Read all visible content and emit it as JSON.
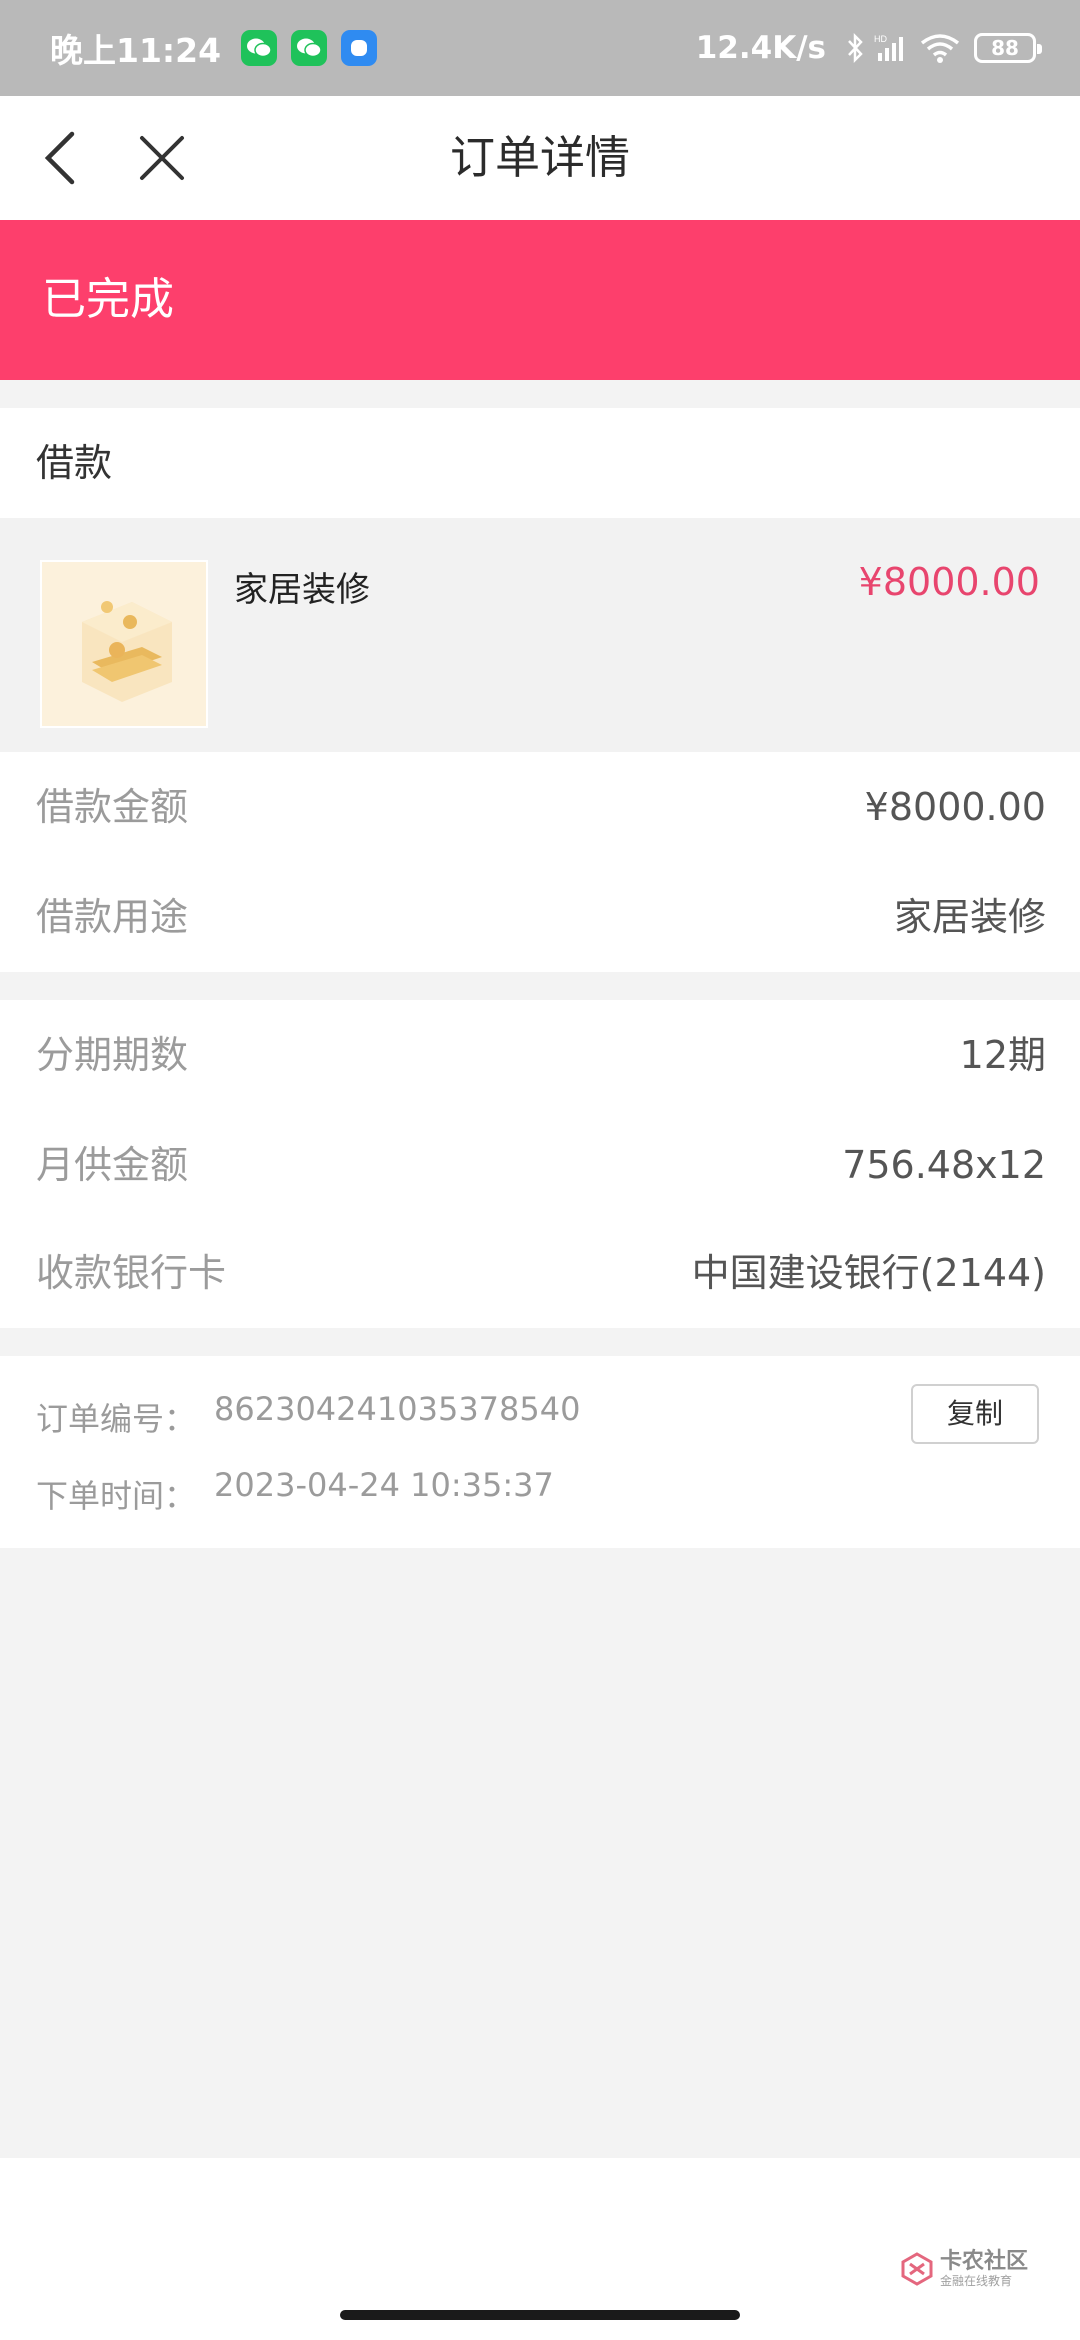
{
  "status_bar": {
    "time": "晚上11:24",
    "network_speed": "12.4K/s",
    "battery": "88",
    "icons": [
      "wechat-icon",
      "wechat-icon",
      "message-app-icon",
      "bluetooth-icon",
      "signal-icon",
      "wifi-icon",
      "battery-icon"
    ]
  },
  "nav": {
    "title": "订单详情",
    "back_icon": "back-arrow-icon",
    "close_icon": "close-icon"
  },
  "banner": {
    "status_text": "已完成",
    "color": "#fd3f6c"
  },
  "loan": {
    "header": "借款",
    "product_name": "家居装修",
    "product_price": "¥8000.00",
    "price_color": "#e8456e"
  },
  "details_1": [
    {
      "label": "借款金额",
      "value": "¥8000.00"
    },
    {
      "label": "借款用途",
      "value": "家居装修"
    }
  ],
  "details_2": [
    {
      "label": "分期期数",
      "value": "12期"
    },
    {
      "label": "月供金额",
      "value": "756.48x12"
    },
    {
      "label": "收款银行卡",
      "value": "中国建设银行(2144)"
    }
  ],
  "order": {
    "number_label": "订单编号：",
    "number_value": "862304241035378540",
    "time_label": "下单时间：",
    "time_value": "2023-04-24 10:35:37",
    "copy_label": "复制"
  },
  "watermark": {
    "title": "卡农社区",
    "subtitle": "金融在线教育"
  }
}
